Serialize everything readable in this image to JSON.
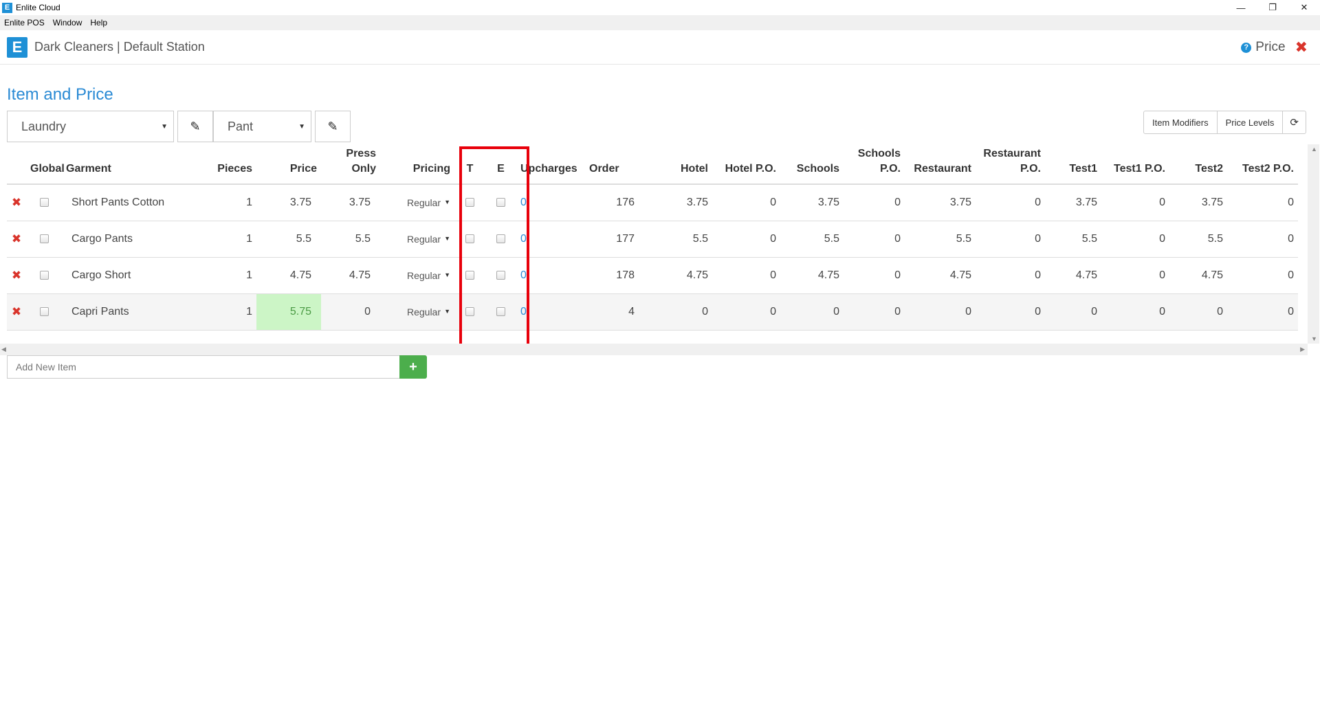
{
  "window": {
    "title": "Enlite Cloud",
    "icon_letter": "E",
    "minimize": "—",
    "restore": "❐",
    "close": "✕"
  },
  "menu": [
    "Enlite POS",
    "Window",
    "Help"
  ],
  "header": {
    "logo_letter": "E",
    "app_name": "Dark Cleaners | Default Station",
    "help_icon": "?",
    "page_label": "Price",
    "close_icon": "✖"
  },
  "page_title": "Item and Price",
  "toolbar": {
    "category": "Laundry",
    "item_type": "Pant",
    "edit_icon": "✎",
    "item_modifiers": "Item Modifiers",
    "price_levels": "Price Levels",
    "refresh_icon": "⟳"
  },
  "table": {
    "headers": {
      "global": "Global",
      "garment": "Garment",
      "pieces": "Pieces",
      "price": "Price",
      "press_only_1": "Press",
      "press_only_2": "Only",
      "pricing": "Pricing",
      "t": "T",
      "e": "E",
      "upcharges": "Upcharges",
      "order": "Order",
      "hotel": "Hotel",
      "hotel_po": "Hotel P.O.",
      "schools": "Schools",
      "schools_po_1": "Schools",
      "schools_po_2": "P.O.",
      "restaurant": "Restaurant",
      "restaurant_po_1": "Restaurant",
      "restaurant_po_2": "P.O.",
      "test1": "Test1",
      "test1_po": "Test1 P.O.",
      "test2": "Test2",
      "test2_po": "Test2 P.O."
    },
    "rows": [
      {
        "garment": "Short Pants Cotton",
        "pieces": "1",
        "price": "3.75",
        "press_only": "3.75",
        "pricing": "Regular",
        "upcharges": "0",
        "order": "176",
        "hotel": "3.75",
        "hotel_po": "0",
        "schools": "3.75",
        "schools_po": "0",
        "restaurant": "3.75",
        "restaurant_po": "0",
        "test1": "3.75",
        "test1_po": "0",
        "test2": "3.75",
        "test2_po": "0"
      },
      {
        "garment": "Cargo Pants",
        "pieces": "1",
        "price": "5.5",
        "press_only": "5.5",
        "pricing": "Regular",
        "upcharges": "0",
        "order": "177",
        "hotel": "5.5",
        "hotel_po": "0",
        "schools": "5.5",
        "schools_po": "0",
        "restaurant": "5.5",
        "restaurant_po": "0",
        "test1": "5.5",
        "test1_po": "0",
        "test2": "5.5",
        "test2_po": "0"
      },
      {
        "garment": "Cargo Short",
        "pieces": "1",
        "price": "4.75",
        "press_only": "4.75",
        "pricing": "Regular",
        "upcharges": "0",
        "order": "178",
        "hotel": "4.75",
        "hotel_po": "0",
        "schools": "4.75",
        "schools_po": "0",
        "restaurant": "4.75",
        "restaurant_po": "0",
        "test1": "4.75",
        "test1_po": "0",
        "test2": "4.75",
        "test2_po": "0"
      },
      {
        "garment": "Capri Pants",
        "pieces": "1",
        "price": "5.75",
        "press_only": "0",
        "pricing": "Regular",
        "upcharges": "0",
        "order": "4",
        "hotel": "0",
        "hotel_po": "0",
        "schools": "0",
        "schools_po": "0",
        "restaurant": "0",
        "restaurant_po": "0",
        "test1": "0",
        "test1_po": "0",
        "test2": "0",
        "test2_po": "0"
      }
    ]
  },
  "add_item": {
    "placeholder": "Add New Item",
    "button_icon": "+"
  },
  "colors": {
    "accent": "#2a8ad4",
    "danger": "#d9342b",
    "success": "#4cae4c",
    "highlight_box": "#e8000b",
    "edited_cell": "#ccf5c6"
  }
}
